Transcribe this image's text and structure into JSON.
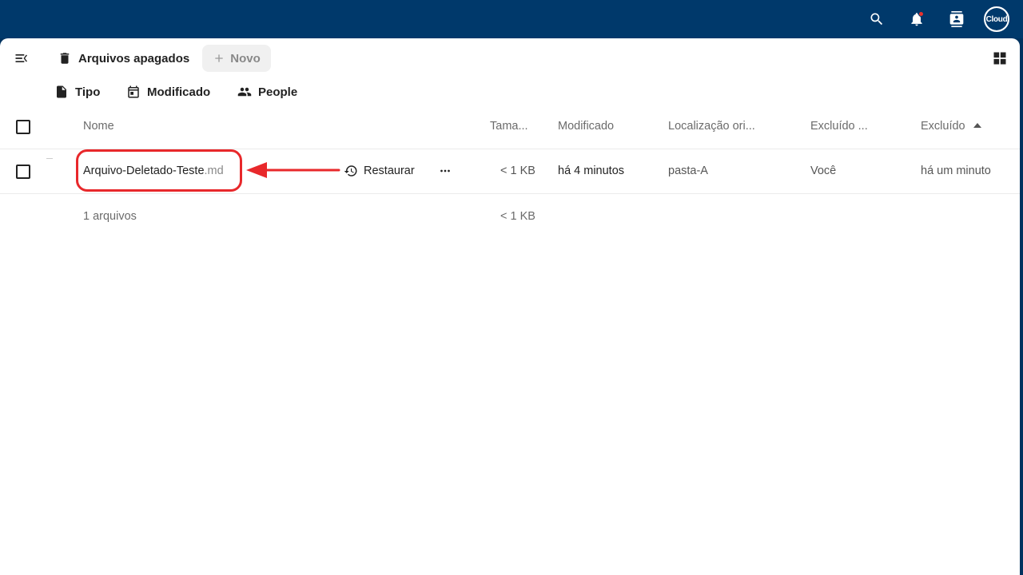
{
  "header": {
    "avatar_text": "Cloud",
    "icons": [
      "search-icon",
      "bell-icon",
      "contacts-icon"
    ]
  },
  "toolbar": {
    "breadcrumb_label": "Arquivos apagados",
    "new_label": "Novo"
  },
  "filters": {
    "type_label": "Tipo",
    "modified_label": "Modificado",
    "people_label": "People"
  },
  "table": {
    "columns": {
      "name": "Nome",
      "size": "Tama...",
      "modified": "Modificado",
      "original_location": "Localização ori...",
      "deleted_by": "Excluído ...",
      "deleted": "Excluído"
    },
    "rows": [
      {
        "name_base": "Arquivo-Deletado-Teste",
        "name_ext": ".md",
        "restore_label": "Restaurar",
        "size": "< 1 KB",
        "modified": "há 4 minutos",
        "original_location": "pasta-A",
        "deleted_by": "Você",
        "deleted": "há um minuto"
      }
    ],
    "footer": {
      "count": "1 arquivos",
      "size": "< 1 KB"
    }
  },
  "colors": {
    "topbar": "#00396b",
    "highlight": "#e8282b"
  }
}
